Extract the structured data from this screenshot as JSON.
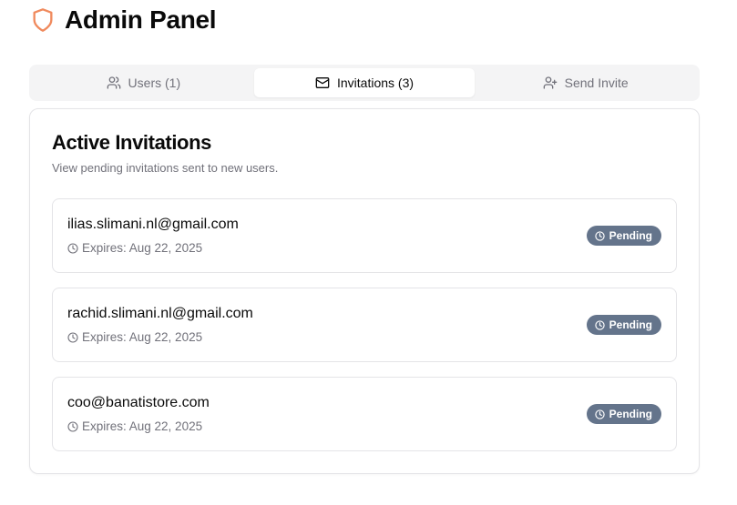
{
  "header": {
    "title": "Admin Panel",
    "icon": "shield-icon",
    "accent_color": "#f08a5d"
  },
  "tabs": [
    {
      "label": "Users (1)",
      "icon": "users-icon",
      "active": false
    },
    {
      "label": "Invitations (3)",
      "icon": "mail-icon",
      "active": true
    },
    {
      "label": "Send Invite",
      "icon": "user-plus-icon",
      "active": false
    }
  ],
  "card": {
    "title": "Active Invitations",
    "subtitle": "View pending invitations sent to new users."
  },
  "invitations": [
    {
      "email": "ilias.slimani.nl@gmail.com",
      "expires": "Expires: Aug 22, 2025",
      "status": "Pending"
    },
    {
      "email": "rachid.slimani.nl@gmail.com",
      "expires": "Expires: Aug 22, 2025",
      "status": "Pending"
    },
    {
      "email": "coo@banatistore.com",
      "expires": "Expires: Aug 22, 2025",
      "status": "Pending"
    }
  ],
  "colors": {
    "badge_bg": "#64748b",
    "muted_text": "#71717a",
    "border": "#e4e4e7",
    "tab_bg": "#f4f4f5"
  }
}
